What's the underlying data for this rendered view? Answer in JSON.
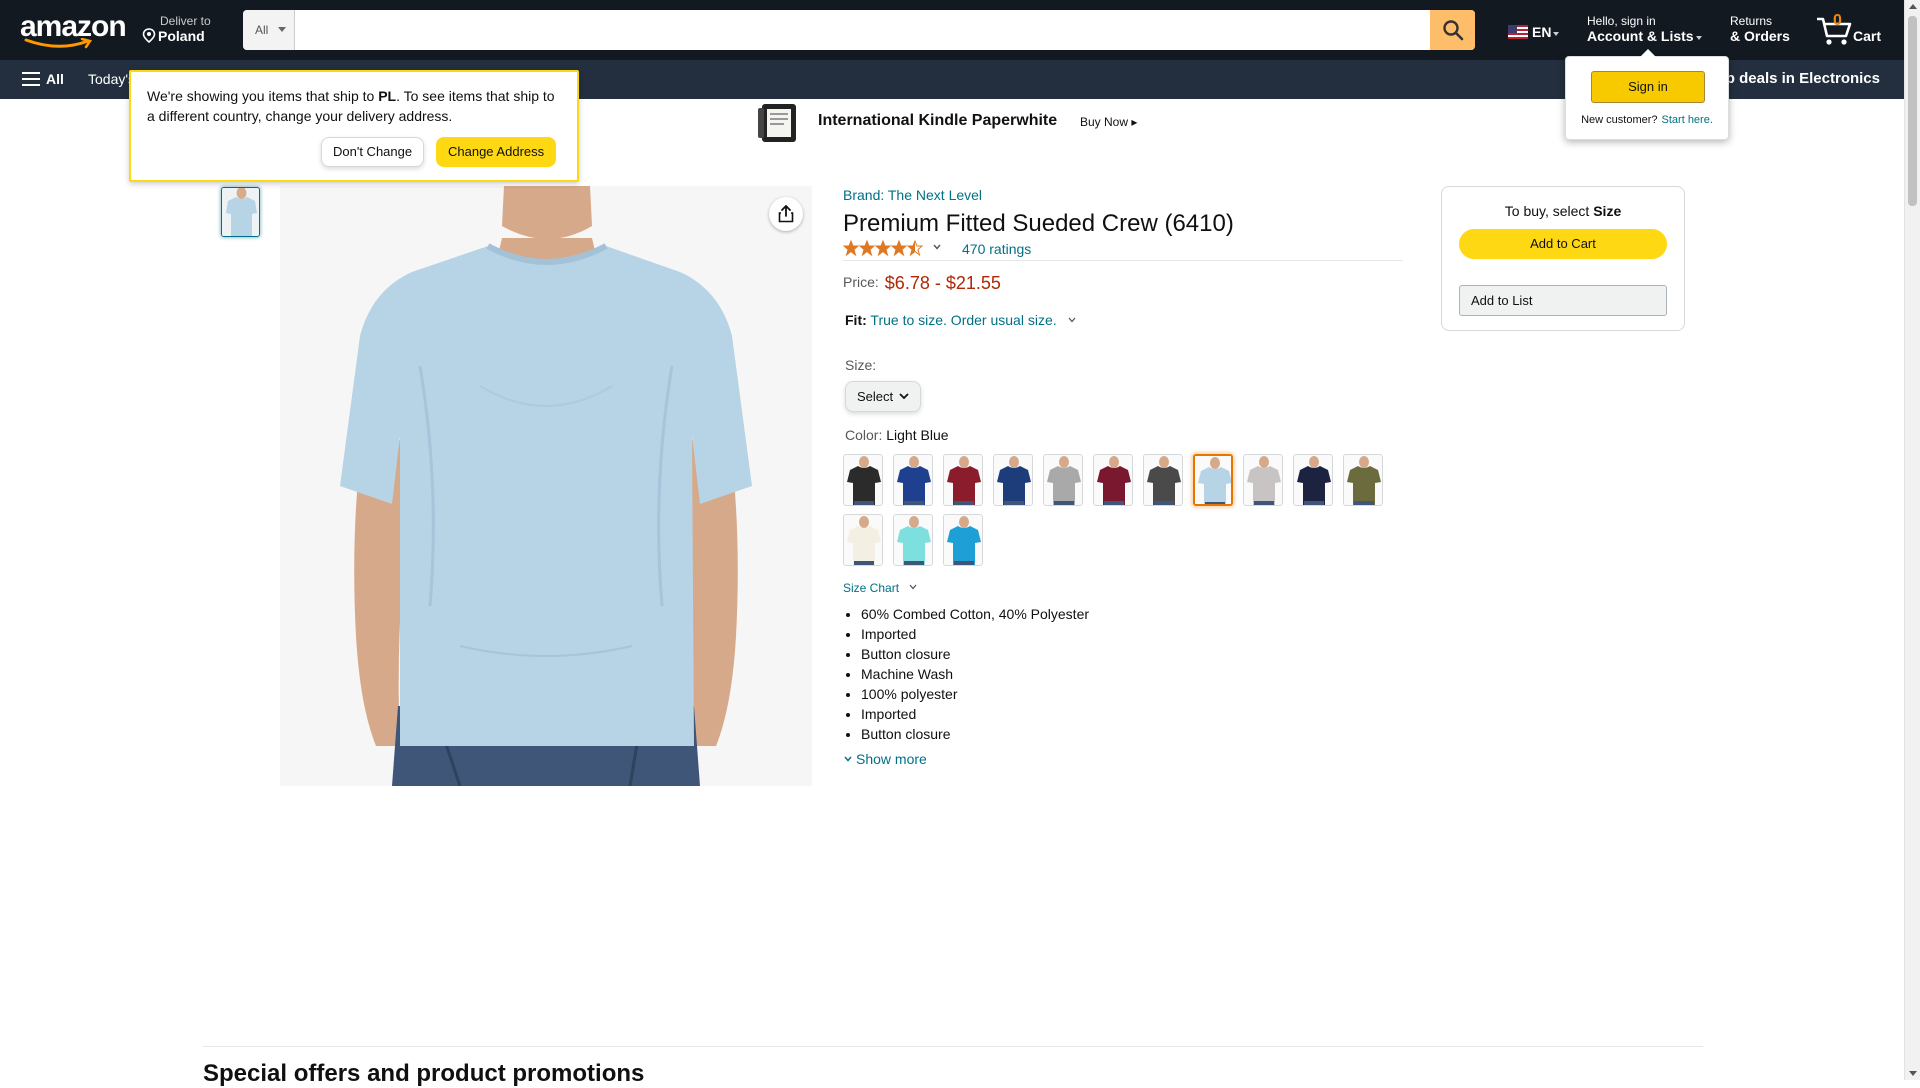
{
  "header": {
    "logo_text": "amazon",
    "deliver_line1": "Deliver to",
    "deliver_line2": "Poland",
    "search_dept": "All",
    "search_placeholder": "",
    "lang": "EN",
    "account_line1": "Hello, sign in",
    "account_line2": "Account & Lists",
    "returns_line1": "Returns",
    "returns_line2": "& Orders",
    "cart_count": "0",
    "cart_label": "Cart"
  },
  "subnav": {
    "all_label": "All",
    "deals_label": "Today's",
    "electronics_label": "op deals in Electronics"
  },
  "banner": {
    "title": "International Kindle Paperwhite",
    "cta": "Buy Now ▸"
  },
  "ship_popover": {
    "text_before": "We're showing you items that ship to ",
    "country": "PL",
    "text_after": ". To see items that ship to a different country, change your delivery address.",
    "dont_change": "Don't Change",
    "change_address": "Change Address"
  },
  "signin_flyout": {
    "button": "Sign in",
    "new_customer": "New customer?",
    "start_here": "Start here."
  },
  "product": {
    "brand": "Brand: The Next Level",
    "title": "Premium Fitted Sueded Crew (6410)",
    "rating": 4.5,
    "ratings_count": "470 ratings",
    "price_label": "Price:",
    "price_range": "$6.78 - $21.55",
    "fit_label": "Fit:",
    "fit_value": "True to size. Order usual size.",
    "size_label": "Size:",
    "size_select": "Select",
    "color_label": "Color:",
    "color_value": "Light Blue",
    "selected_color_index": 7,
    "swatch_colors": [
      "#2b2b2b",
      "#1f3f8f",
      "#8a1c2b",
      "#1d3d7a",
      "#a9a9a9",
      "#7a1830",
      "#4a4a4a",
      "#b7d3e6",
      "#c9c4c4",
      "#1c2340",
      "#6b6b3e",
      "#f3efe3",
      "#7ee0de",
      "#1e9fd6"
    ],
    "size_chart": "Size Chart",
    "bullets": [
      "60% Combed Cotton, 40% Polyester",
      "Imported",
      "Button closure",
      "Machine Wash",
      "100% polyester",
      "Imported",
      "Button closure"
    ],
    "show_more": "Show more",
    "main_shirt_color": "#b7d3e6"
  },
  "buybox": {
    "select_prefix": "To buy, select ",
    "select_bold": "Size",
    "add_to_cart": "Add to Cart",
    "add_to_list": "Add to List"
  },
  "offers_heading": "Special offers and product promotions",
  "colors": {
    "nav_top": "#131921",
    "nav_sub": "#232f3e",
    "search_button": "#febd69",
    "primary_button": "#ffd814",
    "price": "#b12704",
    "link": "#007185",
    "cart_count": "#f08804"
  }
}
